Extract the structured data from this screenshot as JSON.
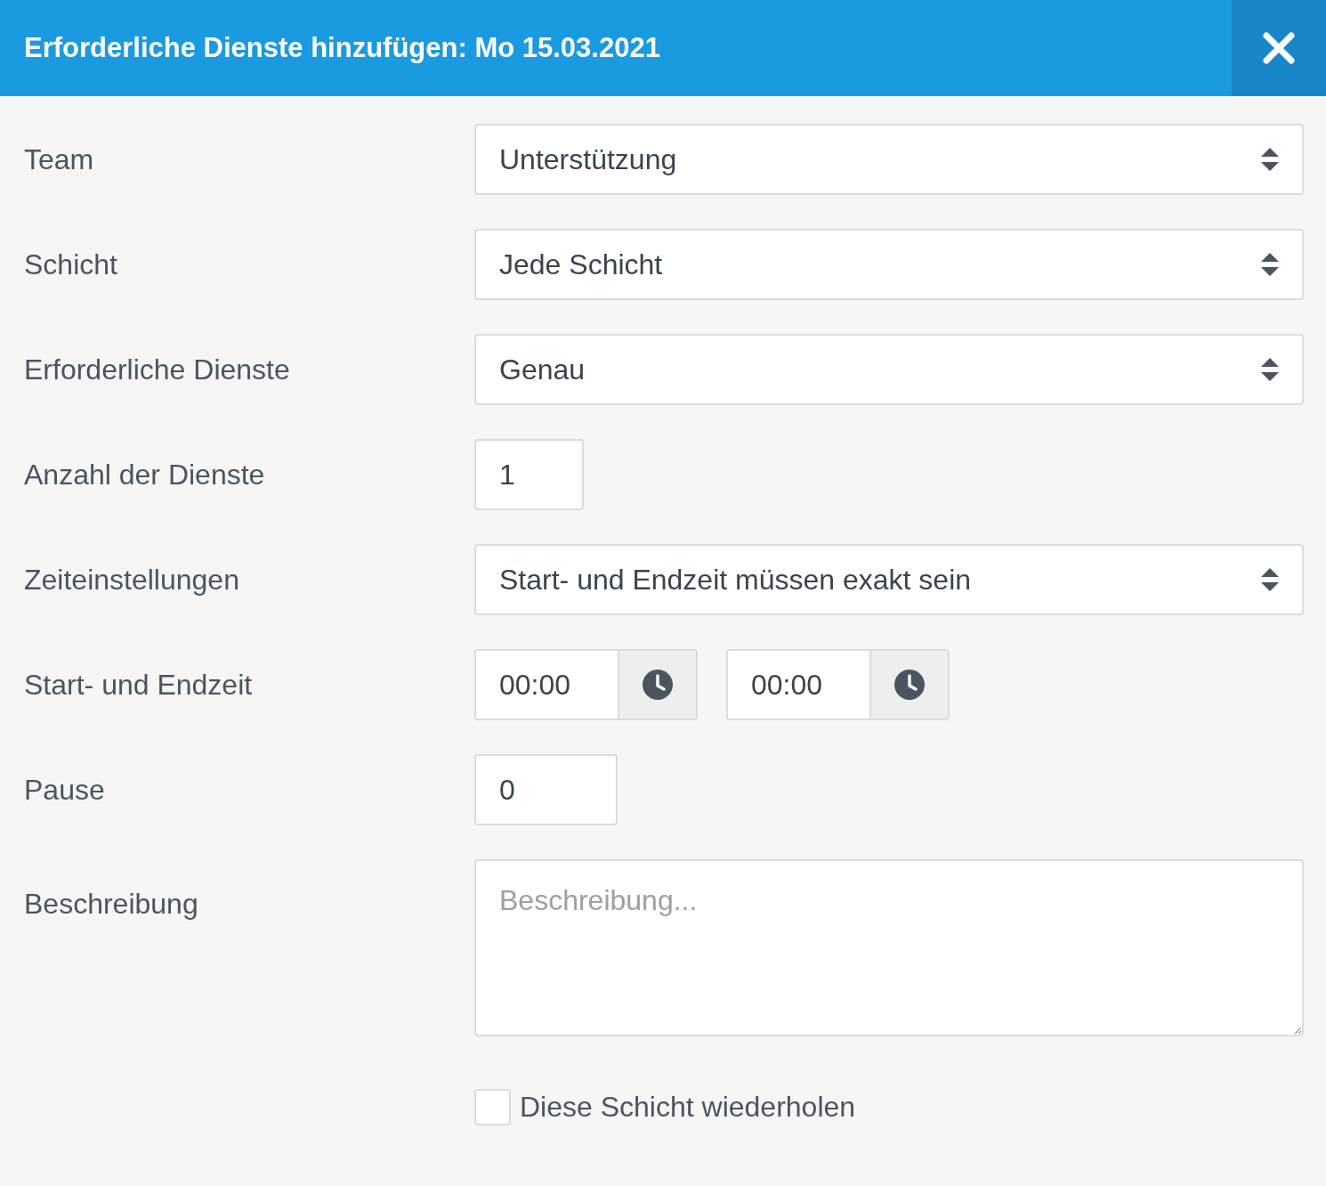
{
  "dialog": {
    "title": "Erforderliche Dienste hinzufügen: Mo 15.03.2021",
    "fields": [
      {
        "kind": "select",
        "label": "Team",
        "value": "Unterstützung"
      },
      {
        "kind": "select",
        "label": "Schicht",
        "value": "Jede Schicht"
      },
      {
        "kind": "select",
        "label": "Erforderliche Dienste",
        "value": "Genau"
      },
      {
        "kind": "count",
        "label": "Anzahl der Dienste",
        "value": "1"
      },
      {
        "kind": "select",
        "label": "Zeiteinstellungen",
        "value": "Start- und Endzeit müssen exakt sein"
      },
      {
        "kind": "times",
        "label": "Start- und Endzeit",
        "values": [
          "00:00",
          "00:00"
        ]
      },
      {
        "kind": "pause",
        "label": "Pause",
        "value": "0"
      },
      {
        "kind": "textarea",
        "label": "Beschreibung",
        "placeholder": "Beschreibung..."
      }
    ],
    "repeat": {
      "label": "Diese Schicht wiederholen",
      "checked": false
    }
  }
}
